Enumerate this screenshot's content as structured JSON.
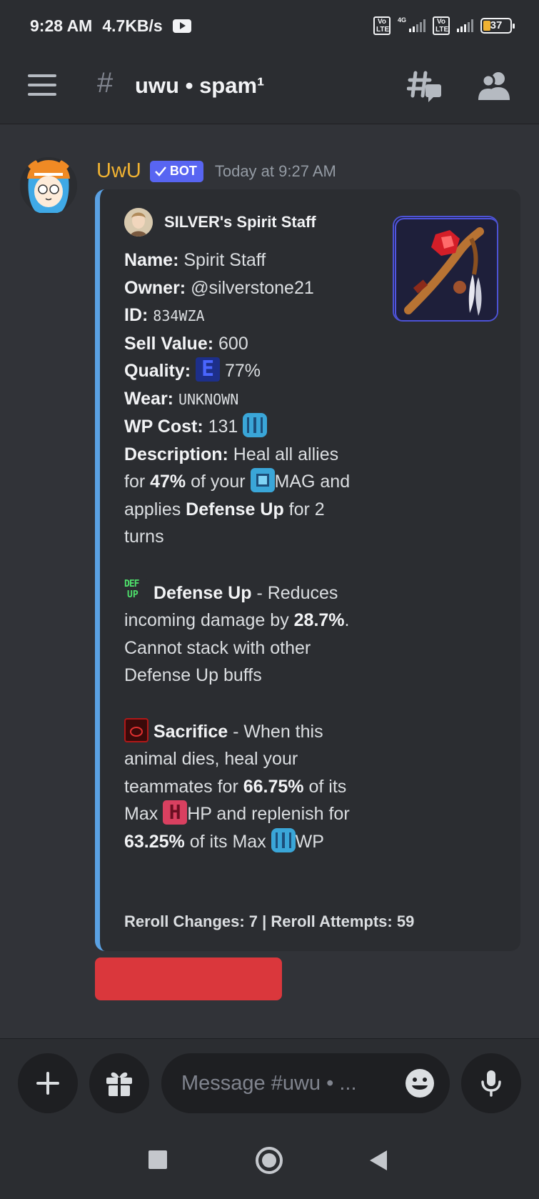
{
  "status_bar": {
    "time": "9:28 AM",
    "speed": "4.7KB/s",
    "volte_label": "Vo LTE",
    "network_label": "4G",
    "battery": "37"
  },
  "header": {
    "hash": "#",
    "channel": "uwu • spam¹"
  },
  "message": {
    "author": "UwU",
    "bot_tag": "BOT",
    "timestamp": "Today at 9:27 AM",
    "embed": {
      "accent_color": "#5aa1e3",
      "author_name": "SILVER's Spirit Staff",
      "fields": {
        "name_label": "Name:",
        "name_value": " Spirit Staff",
        "owner_label": "Owner:",
        "owner_value": " @silverstone21",
        "id_label": "ID:",
        "id_value": "834WZA",
        "sell_label": "Sell Value:",
        "sell_value": " 600",
        "quality_label": "Quality:",
        "quality_value": " 77%",
        "wear_label": "Wear:",
        "wear_value": "UNKNOWN",
        "wp_label": "WP Cost:",
        "wp_value": " 131 "
      },
      "description": {
        "label": "Description:",
        "t1": " Heal all allies for ",
        "pct": "47%",
        "t2": " of your ",
        "t3": "MAG and applies ",
        "buff": "Defense Up",
        "t4": " for 2 turns"
      },
      "defense_up": {
        "title": "Defense Up",
        "t1": " - Reduces incoming damage by ",
        "pct": "28.7%",
        "t2": ". Cannot stack with other Defense Up buffs"
      },
      "sacrifice": {
        "title": "Sacrifice",
        "t1": " - When this animal dies, heal your teammates for ",
        "pct1": "66.75%",
        "t2": " of its Max ",
        "t3": "HP and replenish for ",
        "pct2": "63.25%",
        "t4": " of its Max ",
        "t5": "WP"
      },
      "footer": "Reroll Changes: 7 | Reroll Attempts: 59"
    }
  },
  "composer": {
    "placeholder": "Message #uwu • ..."
  },
  "icons": [
    "menu-icon",
    "threads-icon",
    "members-icon",
    "plus-icon",
    "gift-icon",
    "emoji-icon",
    "mic-icon",
    "verified-check-icon"
  ]
}
